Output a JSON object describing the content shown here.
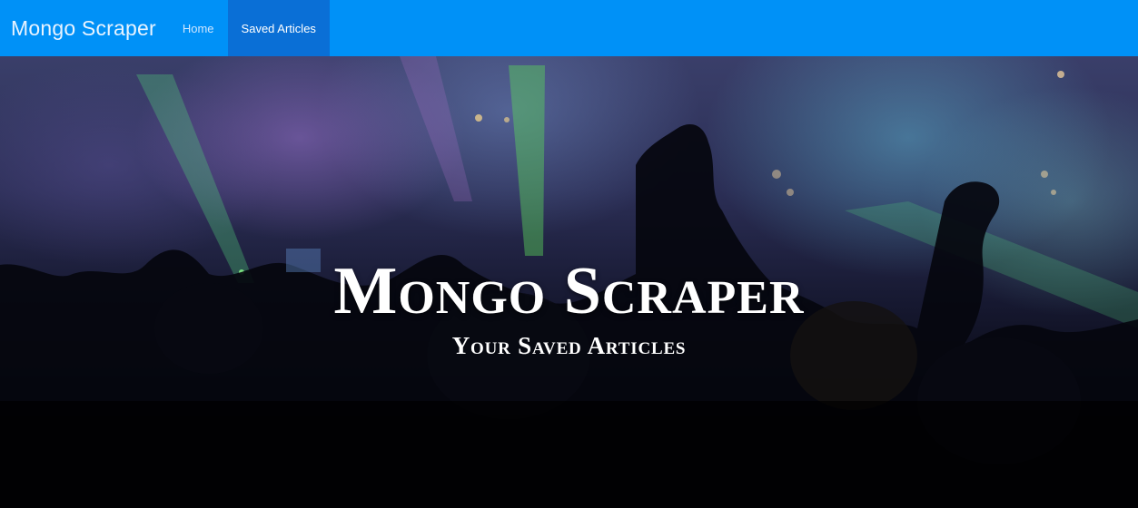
{
  "navbar": {
    "brand": "Mongo Scraper",
    "links": [
      {
        "label": "Home",
        "active": false
      },
      {
        "label": "Saved Articles",
        "active": true
      }
    ],
    "color": "#0091f7",
    "active_color": "#0a6fd6"
  },
  "hero": {
    "title": "Mongo Scraper",
    "subtitle": "Your Saved Articles",
    "background": "concert crowd photo"
  }
}
